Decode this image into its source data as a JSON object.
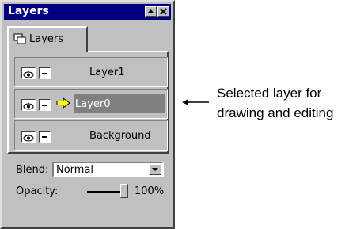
{
  "window": {
    "title": "Layers",
    "tab_label": "Layers"
  },
  "layers": [
    {
      "name": "Layer1",
      "selected": false
    },
    {
      "name": "Layer0",
      "selected": true
    },
    {
      "name": "Background",
      "selected": false
    }
  ],
  "blend": {
    "label": "Blend:",
    "value": "Normal"
  },
  "opacity": {
    "label": "Opacity:",
    "value_text": "100%",
    "value": 1.0
  },
  "callout": {
    "line1": "Selected layer for",
    "line2": "drawing and editing"
  },
  "colors": {
    "title_bar": "#000080",
    "selection": "#808080",
    "face": "#c0c0c0",
    "arrow_fill": "#ffff00"
  }
}
